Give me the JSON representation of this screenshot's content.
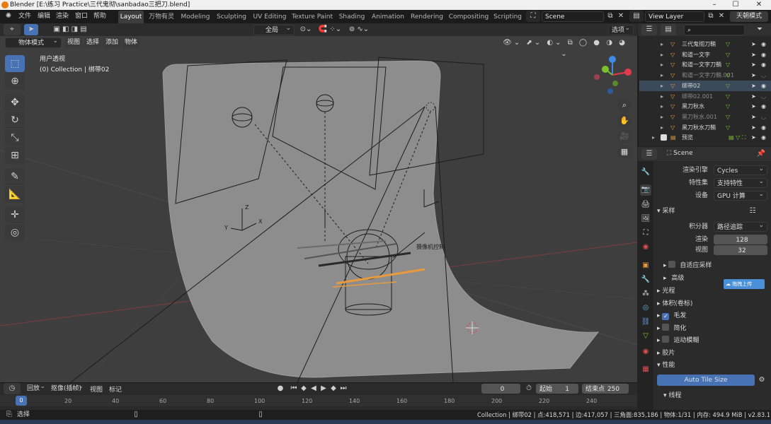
{
  "window": {
    "title": "Blender [E:\\练习 Practice\\三代鬼彻\\sanbadao三把刀.blend]",
    "controls": [
      "–",
      "☐",
      "✕"
    ]
  },
  "menu": [
    "文件",
    "编辑",
    "渲染",
    "窗口",
    "帮助"
  ],
  "workspaces": [
    "Layout",
    "万物有灵",
    "Modeling",
    "Sculpting",
    "UV Editing",
    "Texture Paint",
    "Shading",
    "Animation",
    "Rendering",
    "Compositing",
    "Scripting"
  ],
  "active_workspace": "Layout",
  "scene": {
    "name": "Scene",
    "view_layer": "View Layer",
    "extra_button": "天朝模式"
  },
  "viewport_header": {
    "mode": "物体模式",
    "menus": [
      "视图",
      "选择",
      "添加",
      "物体"
    ],
    "transform_orientation": "全局",
    "options": "选项"
  },
  "viewport": {
    "view_name": "用户透视",
    "collection_info": "(0) Collection | 绑带02",
    "camera_label": "摄像机控制"
  },
  "gizmo_axes": {
    "z": "Z",
    "y": "Y",
    "x": "X"
  },
  "outliner": {
    "rows": [
      {
        "name": "三代鬼彻刀鞘",
        "dim": false,
        "selected": false
      },
      {
        "name": "和道一文字",
        "dim": false,
        "selected": false
      },
      {
        "name": "和道一文字刀鞘",
        "dim": false,
        "selected": false
      },
      {
        "name": "和道一文字刀鞘.001",
        "dim": true,
        "selected": false
      },
      {
        "name": "绑带02",
        "dim": false,
        "selected": true
      },
      {
        "name": "绑带02.001",
        "dim": true,
        "selected": false
      },
      {
        "name": "黑刀秋水",
        "dim": false,
        "selected": false
      },
      {
        "name": "黑刀秋水.001",
        "dim": true,
        "selected": false
      },
      {
        "name": "黑刀秋水刀鞘",
        "dim": false,
        "selected": false
      },
      {
        "name": "预览",
        "dim": false,
        "selected": false
      }
    ]
  },
  "properties": {
    "scene_name": "Scene",
    "render_engine_label": "渲染引擎",
    "render_engine": "Cycles",
    "feature_set_label": "特性集",
    "feature_set": "支持特性",
    "device_label": "设备",
    "device": "GPU 计算",
    "sampling_title": "采样",
    "integrator_label": "积分器",
    "integrator": "路径追踪",
    "render_label": "渲染",
    "render_samples": "128",
    "viewport_label": "视图",
    "viewport_samples": "32",
    "adaptive_sampling": "自适应采样",
    "advanced": "高级",
    "upload_badge": "拖拽上传",
    "panels": [
      {
        "label": "光程",
        "checkbox": false,
        "checked": false
      },
      {
        "label": "体积(卷标)",
        "checkbox": false,
        "checked": false
      },
      {
        "label": "毛发",
        "checkbox": true,
        "checked": true
      },
      {
        "label": "简化",
        "checkbox": true,
        "checked": false
      },
      {
        "label": "运动模糊",
        "checkbox": true,
        "checked": false
      },
      {
        "label": "胶片",
        "checkbox": false,
        "checked": false
      }
    ],
    "performance_title": "性能",
    "auto_tile_size": "Auto Tile Size",
    "threads_title": "线程"
  },
  "timeline": {
    "playback": "回放",
    "keying": "抠像(插帧)",
    "view": "视图",
    "markers": "标记",
    "current_frame": "0",
    "start_label": "起始",
    "start": "1",
    "end_label": "结束点",
    "end": "250",
    "ruler": [
      "0",
      "20",
      "40",
      "60",
      "80",
      "100",
      "120",
      "140",
      "160",
      "180",
      "200",
      "220",
      "240"
    ]
  },
  "status_bar": {
    "left": "选择",
    "right": "Collection | 绑带02 | 点:418,571 | 边:417,057 | 三角面:835,186 | 物体:1/31 | 内存: 494.9 MiB | v2.83.13"
  },
  "colors": {
    "accent": "#4772b3",
    "x_axis": "#e53a4e",
    "y_axis": "#7bc22a",
    "z_axis": "#3d8ae8",
    "object_orange": "#e89a3c"
  }
}
